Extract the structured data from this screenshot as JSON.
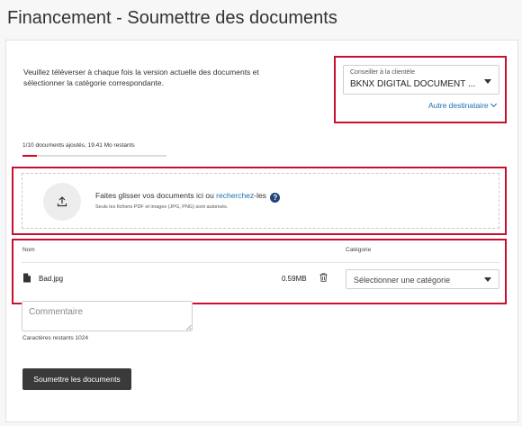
{
  "page": {
    "title": "Financement - Soumettre des documents"
  },
  "intro": {
    "text": "Veuillez téléverser à chaque fois la version actuelle des documents et sélectionner la catégorie correspondante."
  },
  "advisor": {
    "label": "Conseiller à la clientèle",
    "value": "BKNX DIGITAL DOCUMENT ...",
    "other_destination": "Autre destinataire"
  },
  "progress": {
    "text": "1/10 documents ajoutés, 19.41 Mo restants",
    "fraction": 0.1
  },
  "dropzone": {
    "prefix": "Faites glisser vos documents ici ou ",
    "link": "recherchez",
    "suffix": "-les",
    "help": "?",
    "note": "Seuls les fichiers PDF et images (JPG, PNG) sont autorisés."
  },
  "table": {
    "col_name": "Nom",
    "col_category": "Catégorie",
    "rows": [
      {
        "name": "Bad.jpg",
        "size": "0.59MB",
        "category_placeholder": "Sélectionner une catégorie"
      }
    ]
  },
  "comment": {
    "placeholder": "Commentaire",
    "remaining": "Caractères restants 1024"
  },
  "submit": {
    "label": "Soumettre les documents"
  },
  "colors": {
    "accent_red": "#c8102e",
    "link_blue": "#1a6fb0",
    "button_dark": "#3a3a3a"
  },
  "icons": [
    "upload-icon",
    "help-icon",
    "file-icon",
    "trash-icon",
    "chevron-down-icon"
  ]
}
